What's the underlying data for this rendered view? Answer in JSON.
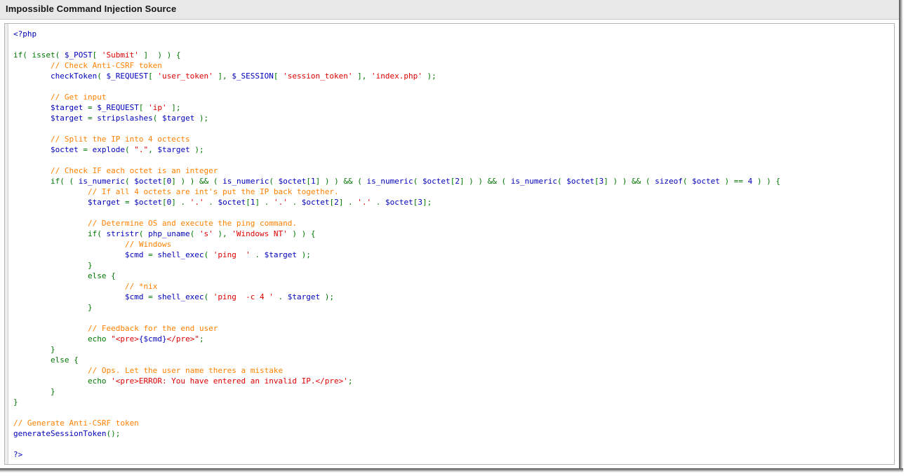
{
  "header": {
    "title": "Impossible Command Injection Source"
  },
  "colors": {
    "header_background": "#e8e8e8",
    "panel_background": "#ffffff",
    "panel_border": "#b4b4b4",
    "gutter": "#eeeeee",
    "token_tag": "#0000bb",
    "token_keyword": "#007700",
    "token_variable": "#0000bb",
    "token_string": "#dd0000",
    "token_comment": "#ff8000",
    "token_number": "#0000bb"
  },
  "code": {
    "language": "php",
    "lines": [
      [
        {
          "t": "<?php",
          "c": "tag"
        }
      ],
      [],
      [
        {
          "t": "if",
          "c": "kw"
        },
        {
          "t": "( ",
          "c": "kw"
        },
        {
          "t": "isset",
          "c": "kw"
        },
        {
          "t": "( ",
          "c": "kw"
        },
        {
          "t": "$_POST",
          "c": "var"
        },
        {
          "t": "[ ",
          "c": "kw"
        },
        {
          "t": "'Submit'",
          "c": "str"
        },
        {
          "t": " ]  ) ) {",
          "c": "kw"
        }
      ],
      [
        {
          "t": "        ",
          "c": "plain"
        },
        {
          "t": "// Check Anti-CSRF token",
          "c": "com"
        }
      ],
      [
        {
          "t": "        ",
          "c": "plain"
        },
        {
          "t": "checkToken",
          "c": "var"
        },
        {
          "t": "( ",
          "c": "kw"
        },
        {
          "t": "$_REQUEST",
          "c": "var"
        },
        {
          "t": "[ ",
          "c": "kw"
        },
        {
          "t": "'user_token'",
          "c": "str"
        },
        {
          "t": " ], ",
          "c": "kw"
        },
        {
          "t": "$_SESSION",
          "c": "var"
        },
        {
          "t": "[ ",
          "c": "kw"
        },
        {
          "t": "'session_token'",
          "c": "str"
        },
        {
          "t": " ], ",
          "c": "kw"
        },
        {
          "t": "'index.php'",
          "c": "str"
        },
        {
          "t": " );",
          "c": "kw"
        }
      ],
      [],
      [
        {
          "t": "        ",
          "c": "plain"
        },
        {
          "t": "// Get input",
          "c": "com"
        }
      ],
      [
        {
          "t": "        ",
          "c": "plain"
        },
        {
          "t": "$target",
          "c": "var"
        },
        {
          "t": " = ",
          "c": "kw"
        },
        {
          "t": "$_REQUEST",
          "c": "var"
        },
        {
          "t": "[ ",
          "c": "kw"
        },
        {
          "t": "'ip'",
          "c": "str"
        },
        {
          "t": " ];",
          "c": "kw"
        }
      ],
      [
        {
          "t": "        ",
          "c": "plain"
        },
        {
          "t": "$target",
          "c": "var"
        },
        {
          "t": " = ",
          "c": "kw"
        },
        {
          "t": "stripslashes",
          "c": "var"
        },
        {
          "t": "( ",
          "c": "kw"
        },
        {
          "t": "$target",
          "c": "var"
        },
        {
          "t": " );",
          "c": "kw"
        }
      ],
      [],
      [
        {
          "t": "        ",
          "c": "plain"
        },
        {
          "t": "// Split the IP into 4 octects",
          "c": "com"
        }
      ],
      [
        {
          "t": "        ",
          "c": "plain"
        },
        {
          "t": "$octet",
          "c": "var"
        },
        {
          "t": " = ",
          "c": "kw"
        },
        {
          "t": "explode",
          "c": "var"
        },
        {
          "t": "( ",
          "c": "kw"
        },
        {
          "t": "\".\"",
          "c": "str"
        },
        {
          "t": ", ",
          "c": "kw"
        },
        {
          "t": "$target",
          "c": "var"
        },
        {
          "t": " );",
          "c": "kw"
        }
      ],
      [],
      [
        {
          "t": "        ",
          "c": "plain"
        },
        {
          "t": "// Check IF each octet is an integer",
          "c": "com"
        }
      ],
      [
        {
          "t": "        ",
          "c": "plain"
        },
        {
          "t": "if",
          "c": "kw"
        },
        {
          "t": "( ( ",
          "c": "kw"
        },
        {
          "t": "is_numeric",
          "c": "var"
        },
        {
          "t": "( ",
          "c": "kw"
        },
        {
          "t": "$octet",
          "c": "var"
        },
        {
          "t": "[",
          "c": "kw"
        },
        {
          "t": "0",
          "c": "num"
        },
        {
          "t": "] ) ) ",
          "c": "kw"
        },
        {
          "t": "&&",
          "c": "kw"
        },
        {
          "t": " ( ",
          "c": "kw"
        },
        {
          "t": "is_numeric",
          "c": "var"
        },
        {
          "t": "( ",
          "c": "kw"
        },
        {
          "t": "$octet",
          "c": "var"
        },
        {
          "t": "[",
          "c": "kw"
        },
        {
          "t": "1",
          "c": "num"
        },
        {
          "t": "] ) ) ",
          "c": "kw"
        },
        {
          "t": "&&",
          "c": "kw"
        },
        {
          "t": " ( ",
          "c": "kw"
        },
        {
          "t": "is_numeric",
          "c": "var"
        },
        {
          "t": "( ",
          "c": "kw"
        },
        {
          "t": "$octet",
          "c": "var"
        },
        {
          "t": "[",
          "c": "kw"
        },
        {
          "t": "2",
          "c": "num"
        },
        {
          "t": "] ) ) ",
          "c": "kw"
        },
        {
          "t": "&&",
          "c": "kw"
        },
        {
          "t": " ( ",
          "c": "kw"
        },
        {
          "t": "is_numeric",
          "c": "var"
        },
        {
          "t": "( ",
          "c": "kw"
        },
        {
          "t": "$octet",
          "c": "var"
        },
        {
          "t": "[",
          "c": "kw"
        },
        {
          "t": "3",
          "c": "num"
        },
        {
          "t": "] ) ) ",
          "c": "kw"
        },
        {
          "t": "&&",
          "c": "kw"
        },
        {
          "t": " ( ",
          "c": "kw"
        },
        {
          "t": "sizeof",
          "c": "var"
        },
        {
          "t": "( ",
          "c": "kw"
        },
        {
          "t": "$octet",
          "c": "var"
        },
        {
          "t": " ) == ",
          "c": "kw"
        },
        {
          "t": "4",
          "c": "num"
        },
        {
          "t": " ) ) {",
          "c": "kw"
        }
      ],
      [
        {
          "t": "                ",
          "c": "plain"
        },
        {
          "t": "// If all 4 octets are int's put the IP back together.",
          "c": "com"
        }
      ],
      [
        {
          "t": "                ",
          "c": "plain"
        },
        {
          "t": "$target",
          "c": "var"
        },
        {
          "t": " = ",
          "c": "kw"
        },
        {
          "t": "$octet",
          "c": "var"
        },
        {
          "t": "[",
          "c": "kw"
        },
        {
          "t": "0",
          "c": "num"
        },
        {
          "t": "] . ",
          "c": "kw"
        },
        {
          "t": "'.'",
          "c": "str"
        },
        {
          "t": " . ",
          "c": "kw"
        },
        {
          "t": "$octet",
          "c": "var"
        },
        {
          "t": "[",
          "c": "kw"
        },
        {
          "t": "1",
          "c": "num"
        },
        {
          "t": "] . ",
          "c": "kw"
        },
        {
          "t": "'.'",
          "c": "str"
        },
        {
          "t": " . ",
          "c": "kw"
        },
        {
          "t": "$octet",
          "c": "var"
        },
        {
          "t": "[",
          "c": "kw"
        },
        {
          "t": "2",
          "c": "num"
        },
        {
          "t": "] . ",
          "c": "kw"
        },
        {
          "t": "'.'",
          "c": "str"
        },
        {
          "t": " . ",
          "c": "kw"
        },
        {
          "t": "$octet",
          "c": "var"
        },
        {
          "t": "[",
          "c": "kw"
        },
        {
          "t": "3",
          "c": "num"
        },
        {
          "t": "];",
          "c": "kw"
        }
      ],
      [],
      [
        {
          "t": "                ",
          "c": "plain"
        },
        {
          "t": "// Determine OS and execute the ping command.",
          "c": "com"
        }
      ],
      [
        {
          "t": "                ",
          "c": "plain"
        },
        {
          "t": "if",
          "c": "kw"
        },
        {
          "t": "( ",
          "c": "kw"
        },
        {
          "t": "stristr",
          "c": "var"
        },
        {
          "t": "( ",
          "c": "kw"
        },
        {
          "t": "php_uname",
          "c": "var"
        },
        {
          "t": "( ",
          "c": "kw"
        },
        {
          "t": "'s'",
          "c": "str"
        },
        {
          "t": " ), ",
          "c": "kw"
        },
        {
          "t": "'Windows NT'",
          "c": "str"
        },
        {
          "t": " ) ) {",
          "c": "kw"
        }
      ],
      [
        {
          "t": "                        ",
          "c": "plain"
        },
        {
          "t": "// Windows",
          "c": "com"
        }
      ],
      [
        {
          "t": "                        ",
          "c": "plain"
        },
        {
          "t": "$cmd",
          "c": "var"
        },
        {
          "t": " = ",
          "c": "kw"
        },
        {
          "t": "shell_exec",
          "c": "var"
        },
        {
          "t": "( ",
          "c": "kw"
        },
        {
          "t": "'ping  '",
          "c": "str"
        },
        {
          "t": " . ",
          "c": "kw"
        },
        {
          "t": "$target",
          "c": "var"
        },
        {
          "t": " );",
          "c": "kw"
        }
      ],
      [
        {
          "t": "                ",
          "c": "plain"
        },
        {
          "t": "}",
          "c": "kw"
        }
      ],
      [
        {
          "t": "                ",
          "c": "plain"
        },
        {
          "t": "else",
          "c": "kw"
        },
        {
          "t": " {",
          "c": "kw"
        }
      ],
      [
        {
          "t": "                        ",
          "c": "plain"
        },
        {
          "t": "// *nix",
          "c": "com"
        }
      ],
      [
        {
          "t": "                        ",
          "c": "plain"
        },
        {
          "t": "$cmd",
          "c": "var"
        },
        {
          "t": " = ",
          "c": "kw"
        },
        {
          "t": "shell_exec",
          "c": "var"
        },
        {
          "t": "( ",
          "c": "kw"
        },
        {
          "t": "'ping  -c 4 '",
          "c": "str"
        },
        {
          "t": " . ",
          "c": "kw"
        },
        {
          "t": "$target",
          "c": "var"
        },
        {
          "t": " );",
          "c": "kw"
        }
      ],
      [
        {
          "t": "                ",
          "c": "plain"
        },
        {
          "t": "}",
          "c": "kw"
        }
      ],
      [],
      [
        {
          "t": "                ",
          "c": "plain"
        },
        {
          "t": "// Feedback for the end user",
          "c": "com"
        }
      ],
      [
        {
          "t": "                ",
          "c": "plain"
        },
        {
          "t": "echo",
          "c": "kw"
        },
        {
          "t": " ",
          "c": "kw"
        },
        {
          "t": "\"<pre>",
          "c": "str"
        },
        {
          "t": "{$cmd}",
          "c": "var"
        },
        {
          "t": "</pre>\"",
          "c": "str"
        },
        {
          "t": ";",
          "c": "kw"
        }
      ],
      [
        {
          "t": "        ",
          "c": "plain"
        },
        {
          "t": "}",
          "c": "kw"
        }
      ],
      [
        {
          "t": "        ",
          "c": "plain"
        },
        {
          "t": "else",
          "c": "kw"
        },
        {
          "t": " {",
          "c": "kw"
        }
      ],
      [
        {
          "t": "                ",
          "c": "plain"
        },
        {
          "t": "// Ops. Let the user name theres a mistake",
          "c": "com"
        }
      ],
      [
        {
          "t": "                ",
          "c": "plain"
        },
        {
          "t": "echo",
          "c": "kw"
        },
        {
          "t": " ",
          "c": "kw"
        },
        {
          "t": "'<pre>ERROR: You have entered an invalid IP.</pre>'",
          "c": "str"
        },
        {
          "t": ";",
          "c": "kw"
        }
      ],
      [
        {
          "t": "        ",
          "c": "plain"
        },
        {
          "t": "}",
          "c": "kw"
        }
      ],
      [
        {
          "t": "}",
          "c": "kw"
        }
      ],
      [],
      [
        {
          "t": "// Generate Anti-CSRF token",
          "c": "com"
        }
      ],
      [
        {
          "t": "generateSessionToken",
          "c": "var"
        },
        {
          "t": "();",
          "c": "kw"
        }
      ],
      [],
      [
        {
          "t": "?>",
          "c": "tag"
        }
      ]
    ]
  }
}
